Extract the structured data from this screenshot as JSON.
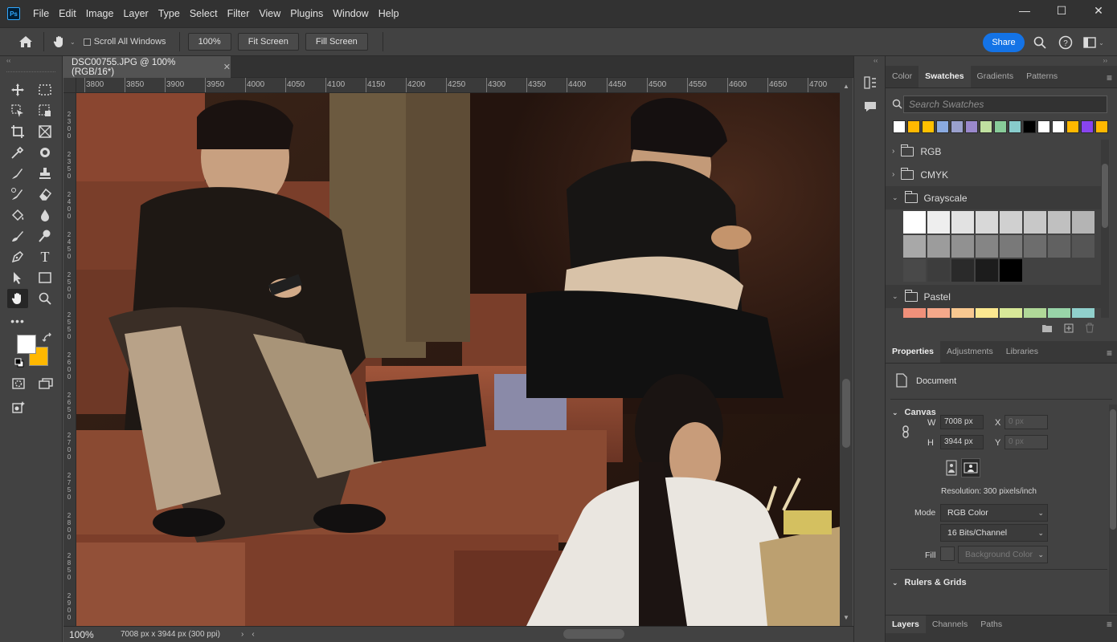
{
  "menubar": {
    "logo": "Ps",
    "items": [
      "File",
      "Edit",
      "Image",
      "Layer",
      "Type",
      "Select",
      "Filter",
      "View",
      "Plugins",
      "Window",
      "Help"
    ]
  },
  "window_controls": {
    "minimize": "—",
    "maximize": "☐",
    "close": "✕"
  },
  "options_bar": {
    "scroll_all_windows": "Scroll All Windows",
    "zoom_button": "100%",
    "fit_screen": "Fit Screen",
    "fill_screen": "Fill Screen",
    "share": "Share"
  },
  "toolbar": {
    "foreground_color": "#ffffff",
    "background_color": "#ffb800",
    "active_tool": "hand-tool"
  },
  "document": {
    "tab_title": "DSC00755.JPG @ 100% (RGB/16*)",
    "ruler_labels": [
      "3800",
      "3850",
      "3900",
      "3950",
      "4000",
      "4050",
      "4100",
      "4150",
      "4200",
      "4250",
      "4300",
      "4350",
      "4400",
      "4450",
      "4500",
      "4550",
      "4600",
      "4650",
      "4700"
    ],
    "vertical_ruler_labels": [
      "2\n3\n0\n0",
      "2\n3\n5\n0",
      "2\n4\n0\n0",
      "2\n4\n5\n0",
      "2\n5\n0\n0",
      "2\n5\n5\n0",
      "2\n6\n0\n0",
      "2\n6\n5\n0",
      "2\n7\n0\n0",
      "2\n7\n5\n0",
      "2\n8\n0\n0",
      "2\n8\n5\n0",
      "2\n9\n0\n0",
      "2\n9\n5\n0"
    ],
    "zoom": "100%",
    "info": "7008 px x 3944 px (300 ppi)"
  },
  "swatches_panel": {
    "tabs": [
      "Color",
      "Swatches",
      "Gradients",
      "Patterns"
    ],
    "active_tab": "Swatches",
    "search_placeholder": "Search Swatches",
    "recent_colors": [
      "#ffffff",
      "#ffb800",
      "#ffc000",
      "#8aaae0",
      "#9aa0cc",
      "#9a88cc",
      "#c0e0a0",
      "#88cc99",
      "#88cccc",
      "#000000",
      "#ffffff",
      "#ffffff",
      "#ffb800",
      "#8844ee",
      "#ffb800"
    ],
    "groups": [
      {
        "name": "RGB",
        "expanded": false
      },
      {
        "name": "CMYK",
        "expanded": false
      },
      {
        "name": "Grayscale",
        "expanded": true
      },
      {
        "name": "Pastel",
        "expanded": true
      }
    ],
    "grayscale": [
      "#ffffff",
      "#eeeeee",
      "#e2e2e2",
      "#d8d8d8",
      "#d0d0d0",
      "#c8c8c8",
      "#c0c0c0",
      "#b4b4b4",
      "#a8a8a8",
      "#9c9c9c",
      "#919191",
      "#858585",
      "#797979",
      "#6d6d6d",
      "#616161",
      "#555555",
      "#494949",
      "#3d3d3d",
      "#2a2a2a",
      "#1c1c1c",
      "#000000"
    ],
    "pastel": [
      "#f0907a",
      "#f4a88a",
      "#f8c890",
      "#fce890",
      "#d8e898",
      "#b0d898",
      "#98d4a8",
      "#90d0cc"
    ]
  },
  "properties_panel": {
    "tabs": [
      "Properties",
      "Adjustments",
      "Libraries"
    ],
    "active_tab": "Properties",
    "document_label": "Document",
    "canvas_section": "Canvas",
    "w_label": "W",
    "w_value": "7008 px",
    "x_label": "X",
    "x_value": "0 px",
    "h_label": "H",
    "h_value": "3944 px",
    "y_label": "Y",
    "y_value": "0 px",
    "resolution": "Resolution: 300 pixels/inch",
    "mode_label": "Mode",
    "mode_value": "RGB Color",
    "bits_value": "16 Bits/Channel",
    "fill_label": "Fill",
    "fill_value": "Background Color",
    "rulers_section": "Rulers & Grids"
  },
  "bottom_tabs": [
    "Layers",
    "Channels",
    "Paths"
  ],
  "bottom_active_tab": "Layers"
}
